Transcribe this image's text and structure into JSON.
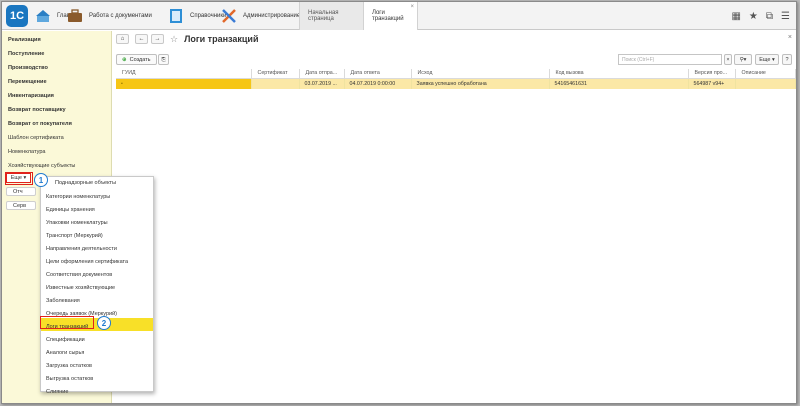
{
  "topbar": {
    "sections": [
      {
        "label": "Главное",
        "icon": "home-icon"
      },
      {
        "label": "Работа с документами",
        "icon": "briefcase-icon"
      },
      {
        "label": "Справочники",
        "icon": "book-icon"
      },
      {
        "label": "Администрирование",
        "icon": "tools-icon"
      }
    ],
    "tabs": [
      {
        "label": "Начальная страница"
      },
      {
        "label": "Логи транзакций",
        "close": "×"
      }
    ]
  },
  "sidebar": {
    "items": [
      {
        "label": "Реализация"
      },
      {
        "label": "Поступление"
      },
      {
        "label": "Производство"
      },
      {
        "label": "Перемещение"
      },
      {
        "label": "Инвентаризация"
      },
      {
        "label": "Возврат поставщику"
      },
      {
        "label": "Возврат от покупателя"
      },
      {
        "label": "Шаблон сертификата"
      },
      {
        "label": "Номенклатура"
      },
      {
        "label": "Хозяйствующие субъекты"
      }
    ],
    "more_label": "Еще ▾",
    "stub1": "Отч",
    "stub2": "Серв"
  },
  "main": {
    "title": "Логи транзакций",
    "create_label": "Создать",
    "search_placeholder": "Поиск (Ctrl+F)",
    "more_label": "Еще ▾",
    "help_label": "?",
    "columns": [
      "ГУИД",
      "Сертификат",
      "Дата отпра...",
      "Дата ответа",
      "Исход",
      "Код вызова",
      "Версия про...",
      "Описание"
    ],
    "rows": [
      [
        "",
        "",
        "03.07.2019 ...",
        "04.07.2019 0:00:00",
        "Заявка успешно обработана",
        "54165461631",
        "564987 v94+",
        ""
      ]
    ]
  },
  "popup": {
    "items": [
      "Поднадзорные объекты",
      "Категории номенклатуры",
      "Единицы хранения",
      "Упаковки номенклатуры",
      "Транспорт (Меркурий)",
      "Направления деятельности",
      "Цели оформления сертификата",
      "Соответствия документов",
      "Известные хозяйствующие",
      "Заболевания",
      "Очередь заявок (Меркурий)",
      "Логи транзакций",
      "Спецификации",
      "Аналоги сырья",
      "Загрузка остатков",
      "Выгрузка остатков",
      "Слияние"
    ]
  },
  "badges": {
    "one": "1",
    "two": "2"
  }
}
